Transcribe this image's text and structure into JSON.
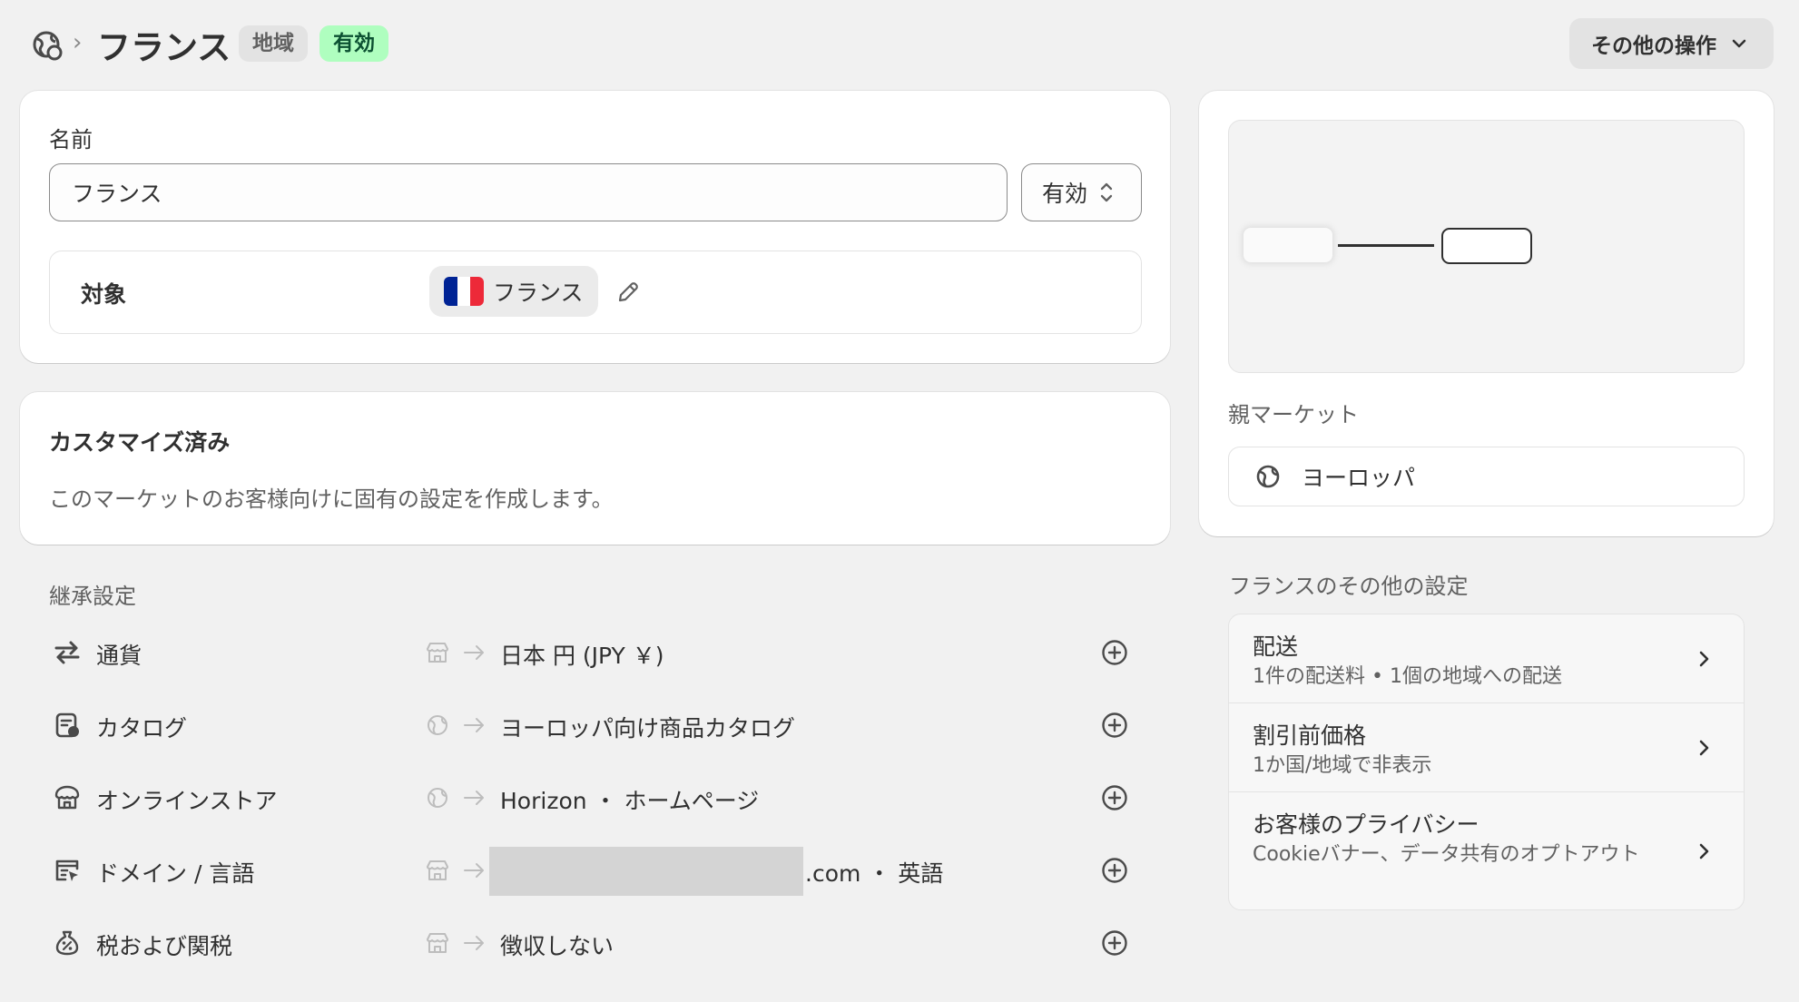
{
  "header": {
    "breadcrumb_separator": "›",
    "title": "フランス",
    "badges": {
      "region": "地域",
      "active": "有効"
    },
    "more_actions": "その他の操作"
  },
  "main_card": {
    "name_label": "名前",
    "name_value": "フランス",
    "status_value": "有効",
    "target_label": "対象",
    "country": "フランス",
    "flag_colors": [
      "#002395",
      "#ffffff",
      "#ed2939"
    ]
  },
  "custom_card": {
    "title": "カスタマイズ済み",
    "description": "このマーケットのお客様向けに固有の設定を作成します。"
  },
  "inherited": {
    "title": "継承設定",
    "rows": [
      {
        "icon": "currency-exchange-icon",
        "name": "通貨",
        "source": "store-icon",
        "value": "日本 円 (JPY ￥)"
      },
      {
        "icon": "catalog-icon",
        "name": "カタログ",
        "source": "globe-icon",
        "value": "ヨーロッパ向け商品カタログ"
      },
      {
        "icon": "online-store-icon",
        "name": "オンラインストア",
        "source": "globe-icon",
        "value": "Horizon ・ ホームページ"
      },
      {
        "icon": "domain-icon",
        "name": "ドメイン / 言語",
        "source": "store-icon",
        "value": ".com ・ 英語"
      },
      {
        "icon": "tax-icon",
        "name": "税および関税",
        "source": "store-icon",
        "value": "徴収しない"
      }
    ]
  },
  "map_card": {
    "parent_label": "親マーケット",
    "parent_value": "ヨーロッパ"
  },
  "other_settings": {
    "title": "フランスのその他の設定",
    "items": [
      {
        "title": "配送",
        "subtitle": "1件の配送料 • 1個の地域への配送"
      },
      {
        "title": "割引前価格",
        "subtitle": "1か国/地域で非表示"
      },
      {
        "title": "お客様のプライバシー",
        "subtitle": "Cookieバナー、データ共有のオプトアウト"
      }
    ]
  },
  "colors": {
    "background": "#f1f1f1",
    "card": "#ffffff",
    "badge_active_bg": "#affebf",
    "badge_active_text": "#0c5132",
    "badge_region_bg": "#e3e3e3"
  }
}
